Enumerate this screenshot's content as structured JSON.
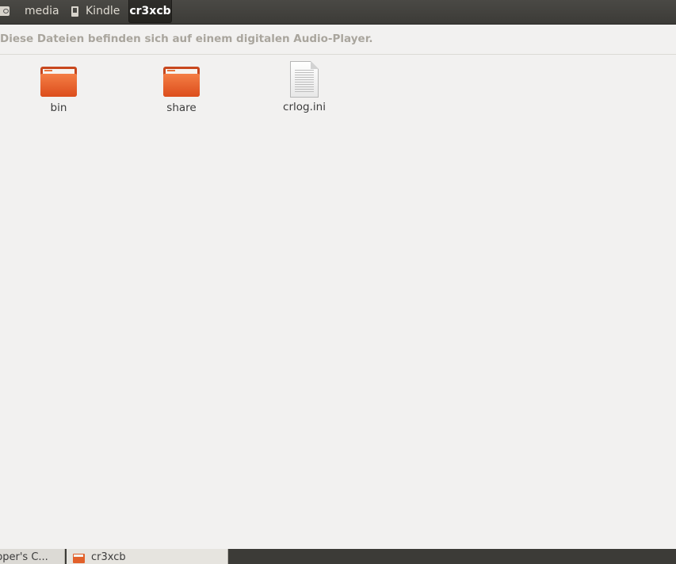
{
  "breadcrumb": {
    "root_icon": "drive-icon",
    "items": [
      {
        "label": "media"
      },
      {
        "label": "Kindle",
        "icon": "kindle-device-icon"
      },
      {
        "label": "cr3xcb",
        "active": true
      }
    ]
  },
  "infobar": {
    "message": "Diese Dateien befinden sich auf einem digitalen Audio-Player."
  },
  "files": [
    {
      "name": "bin",
      "type": "folder",
      "icon": "folder-icon"
    },
    {
      "name": "share",
      "type": "folder",
      "icon": "folder-icon"
    },
    {
      "name": "crlog.ini",
      "type": "file",
      "icon": "text-file-icon"
    }
  ],
  "taskbar": {
    "items": [
      {
        "label": "pper's C..."
      },
      {
        "label": "cr3xcb",
        "icon": "folder-icon"
      }
    ]
  },
  "colors": {
    "topbar": "#3c3b37",
    "folder_orange": "#e8602c",
    "background": "#f2f1f0",
    "info_text": "#a9a59d"
  }
}
